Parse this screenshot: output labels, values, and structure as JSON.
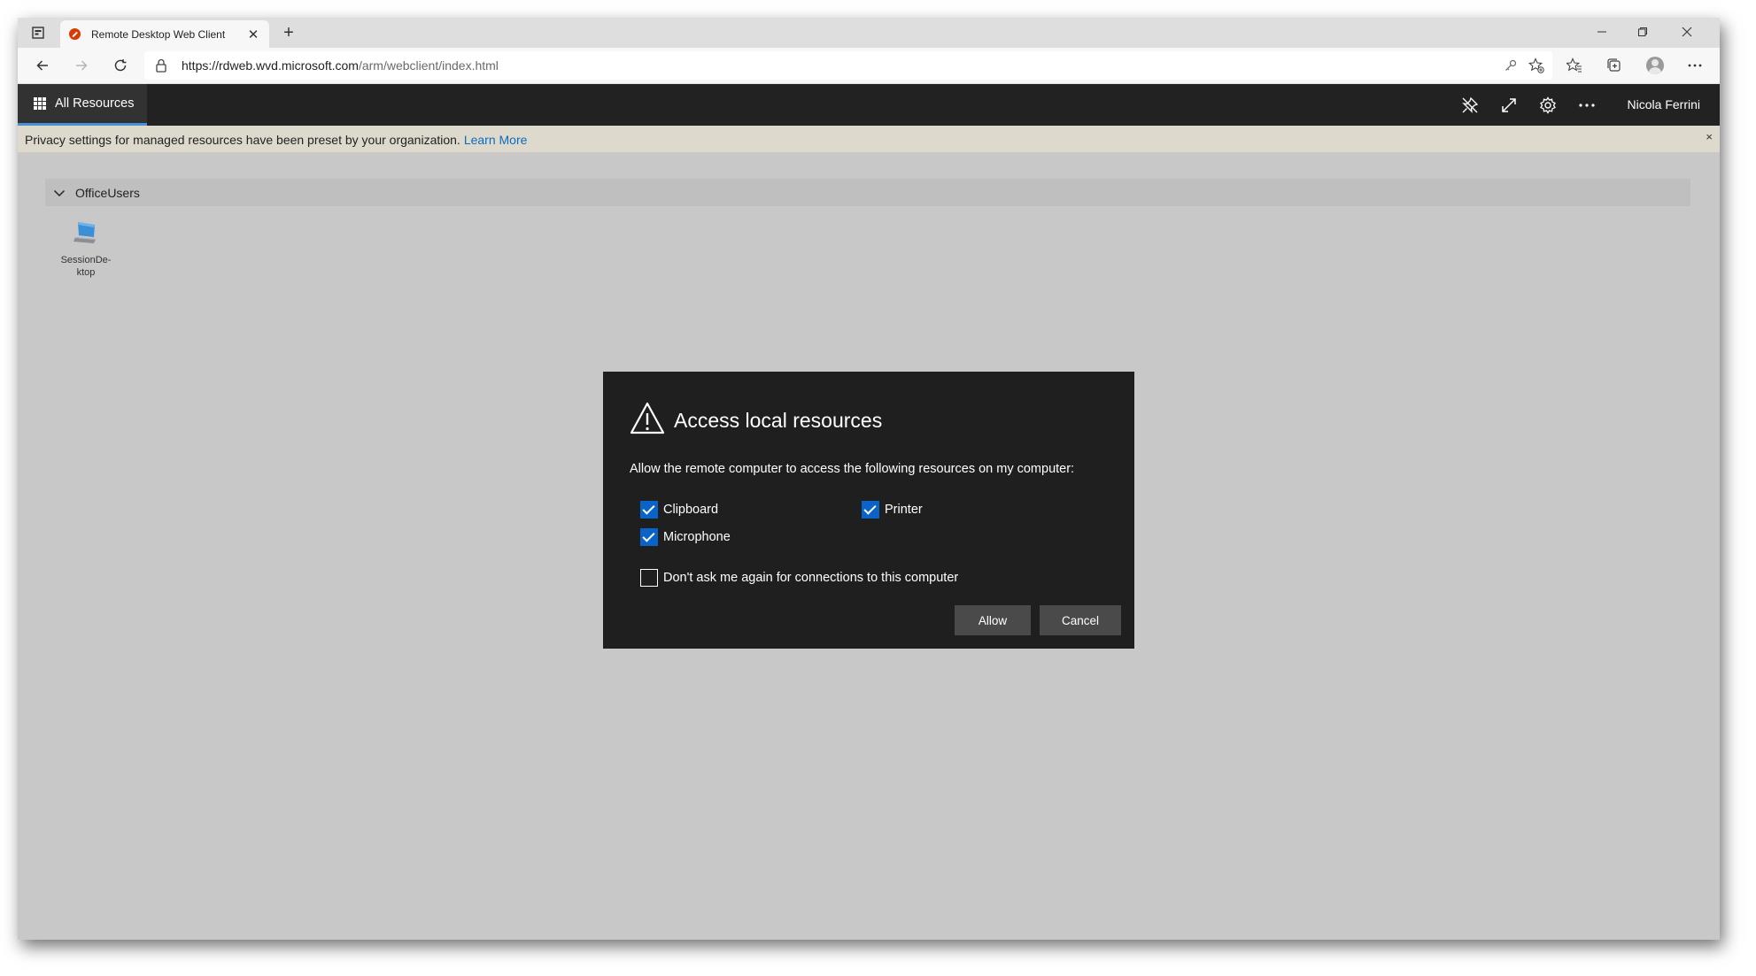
{
  "browser": {
    "tab_title": "Remote Desktop Web Client",
    "new_tab_glyph": "+",
    "url_host": "https://rdweb.wvd.microsoft.com",
    "url_path": "/arm/webclient/index.html"
  },
  "app": {
    "nav_label": "All Resources",
    "user_name": "Nicola Ferrini"
  },
  "banner": {
    "message": "Privacy settings for managed resources have been preset by your organization.",
    "link": "Learn More",
    "close_glyph": "×"
  },
  "group": {
    "name": "OfficeUsers"
  },
  "resources": [
    {
      "name_line1": "SessionDe-",
      "name_line2": "ktop"
    }
  ],
  "dialog": {
    "title": "Access local resources",
    "description": "Allow the remote computer to access the following resources on my computer:",
    "options": [
      {
        "label": "Clipboard",
        "checked": true
      },
      {
        "label": "Printer",
        "checked": true
      },
      {
        "label": "Microphone",
        "checked": true
      }
    ],
    "dont_ask": {
      "label": "Don't ask me again for connections to this computer",
      "checked": false
    },
    "allow_label": "Allow",
    "cancel_label": "Cancel"
  },
  "colors": {
    "header_bg": "#222222",
    "dialog_bg": "#1f1f1f",
    "checkbox_accent": "#0a64c8",
    "link": "#0f6cbd",
    "content_bg": "#c8c8c8",
    "banner_bg": "#ddd9cd"
  },
  "icons": {
    "browser": [
      "tab-actions-icon",
      "back-icon",
      "forward-icon",
      "refresh-icon",
      "lock-icon",
      "key-icon",
      "add-favorite-icon",
      "favorites-icon",
      "collections-icon",
      "profile-icon",
      "more-icon"
    ],
    "header": [
      "unpin-icon",
      "fullscreen-icon",
      "gear-icon",
      "ellipsis-icon"
    ],
    "content": [
      "chevron-down-icon",
      "desktop-icon",
      "warning-icon",
      "checkmark-icon"
    ]
  }
}
